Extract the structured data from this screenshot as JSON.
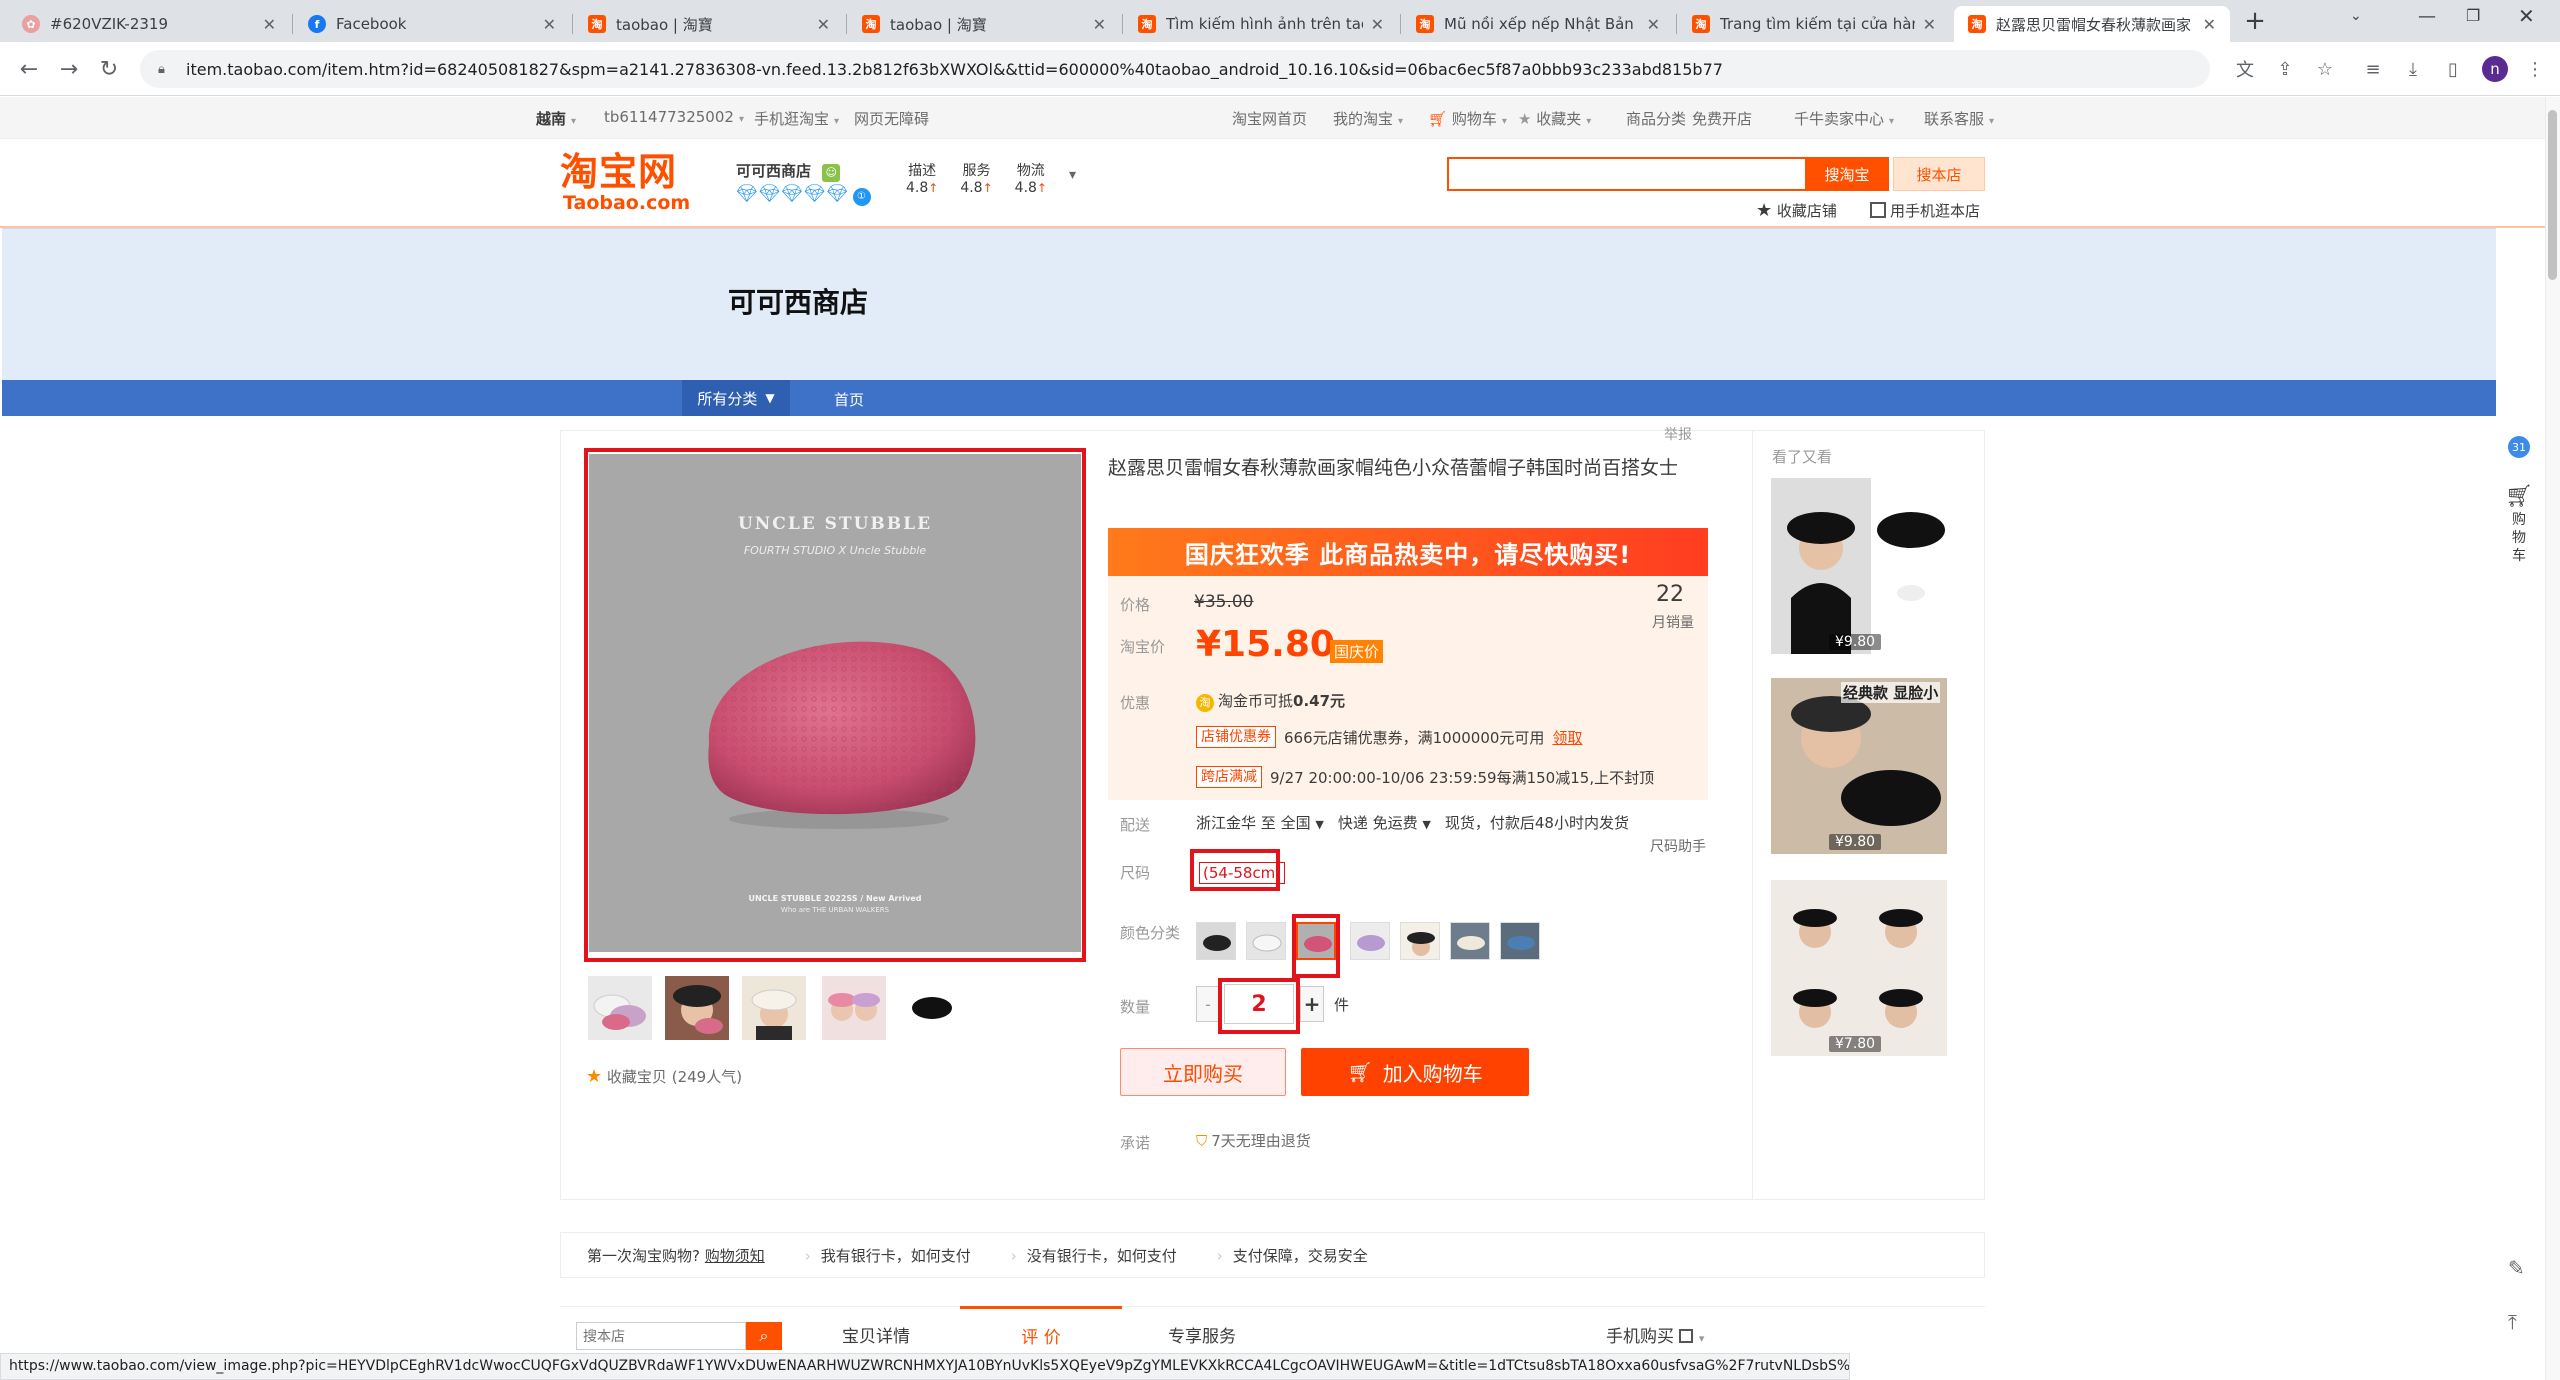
{
  "browser": {
    "tabs": [
      {
        "title": "#620VZIK-2319",
        "icon": "web-icon"
      },
      {
        "title": "Facebook",
        "icon": "facebook-icon"
      },
      {
        "title": "taobao | 淘寶",
        "icon": "taobao-icon"
      },
      {
        "title": "taobao | 淘寶",
        "icon": "taobao-icon"
      },
      {
        "title": "Tìm kiếm hình ảnh trên taob",
        "icon": "taobao-icon"
      },
      {
        "title": "Mũ nồi xếp nếp Nhật Bản dà",
        "icon": "taobao-icon"
      },
      {
        "title": "Trang tìm kiếm tại cửa hàng·",
        "icon": "taobao-icon"
      },
      {
        "title": "赵露思贝雷帽女春秋薄款画家",
        "icon": "taobao-icon"
      }
    ],
    "new_tab": "+",
    "url": "item.taobao.com/item.htm?id=682405081827&spm=a2141.27836308-vn.feed.13.2b812f63bXWXOl&&ttid=600000%40taobao_android_10.16.10&sid=06bac6ec5f87a0bbb93c233abd815b77",
    "profile_initial": "n",
    "status_url": "https://www.taobao.com/view_image.php?pic=HEYVDlpCEghRV1dcWwocCUQFGxVdQUZBVRdaWF1YWVxDUwENAARHWUZWRCNHMXYJA10BYnUvKls5XQEyeV9pZgYMLEVKXkRCCA4LCgcOAVIHWEUGAwM=&title=1dTCtsu8sbTA18Oxxa60usfvsaG%2F7rutvNLDsbS%2FyavQodba3e3A2cOx19O6q7n6yrHJ0LDZtO7Frsq%2F&version=2&c=MjIwMDc5OTM2MjA1Mg%3D%3D&seller..."
  },
  "site_nav": {
    "region": "越南",
    "user": "tb611477325002",
    "mobile": "手机逛淘宝",
    "accessibility": "网页无障碍",
    "home": "淘宝网首页",
    "my_taobao": "我的淘宝",
    "cart": "购物车",
    "favorites": "收藏夹",
    "categories": "商品分类",
    "open_shop": "免费开店",
    "seller_center": "千牛卖家中心",
    "service": "联系客服"
  },
  "header": {
    "logo_cn": "淘宝网",
    "logo_en": "Taobao.com",
    "shop_name": "可可西商店",
    "ratings": [
      {
        "label": "描述",
        "value": "4.8"
      },
      {
        "label": "服务",
        "value": "4.8"
      },
      {
        "label": "物流",
        "value": "4.8"
      }
    ],
    "search_placeholder": "",
    "search_taobao": "搜淘宝",
    "search_shop": "搜本店",
    "fav_shop": "收藏店铺",
    "mobile_shop": "用手机逛本店"
  },
  "banner": {
    "shop_title": "可可西商店",
    "menu_all": "所有分类",
    "menu_home": "首页"
  },
  "product": {
    "report": "举报",
    "title": "赵露思贝雷帽女春秋薄款画家帽纯色小众蓓蕾帽子韩国时尚百搭女士",
    "promo": "国庆狂欢季  此商品热卖中，请尽快购买!",
    "price_label": "价格",
    "original_price": "¥35.00",
    "monthly_sales": "22",
    "monthly_sales_label": "月销量",
    "taobao_price_label": "淘宝价",
    "current_price": "¥15.80",
    "price_tag": "国庆价",
    "discount_label": "优惠",
    "coin_text": "淘金币可抵",
    "coin_value": "0.47元",
    "coupon_tag": "店铺优惠券",
    "coupon_text": "666元店铺优惠券，满1000000元可用",
    "coupon_link": "领取",
    "cross_tag": "跨店满减",
    "cross_text": "9/27 20:00:00-10/06 23:59:59每满150减15,上不封顶",
    "delivery_label": "配送",
    "delivery_from": "浙江金华 至",
    "delivery_to": "全国",
    "delivery_method": "快递 免运费",
    "delivery_note": "现货，付款后48小时内发货",
    "size_helper": "尺码助手",
    "size_label": "尺码",
    "size_value": "(54-58cm)",
    "color_label": "颜色分类",
    "qty_label": "数量",
    "qty_minus": "-",
    "qty_value": "2",
    "qty_plus": "+",
    "qty_unit": "件",
    "buy_now": "立即购买",
    "add_cart": "加入购物车",
    "promise_label": "承诺",
    "promise_text": "7天无理由退货",
    "collect": "收藏宝贝",
    "popularity": "(249人气)",
    "img_brand": "UNCLE STUBBLE",
    "img_collab": "FOURTH STUDIO X Uncle Stubble",
    "img_footer": "UNCLE STUBBLE 2022SS / New Arrived",
    "img_footer2": "Who are THE URBAN WALKERS"
  },
  "recommend": {
    "title": "看了又看",
    "items": [
      {
        "price": "¥9.80"
      },
      {
        "price": "¥9.80",
        "badge": "经典款 显脸小"
      },
      {
        "price": "¥7.80"
      }
    ]
  },
  "guide": {
    "first_time": "第一次淘宝购物?",
    "first_link": "购物须知",
    "bank_card": "我有银行卡，如何支付",
    "no_bank": "没有银行卡，如何支付",
    "guarantee": "支付保障，交易安全"
  },
  "lower_tabs": {
    "search_placeholder": "搜本店",
    "details": "宝贝详情",
    "reviews": "评 价",
    "service": "专享服务",
    "mobile_buy": "手机购买"
  },
  "sidebar": {
    "cart": "购物车"
  }
}
